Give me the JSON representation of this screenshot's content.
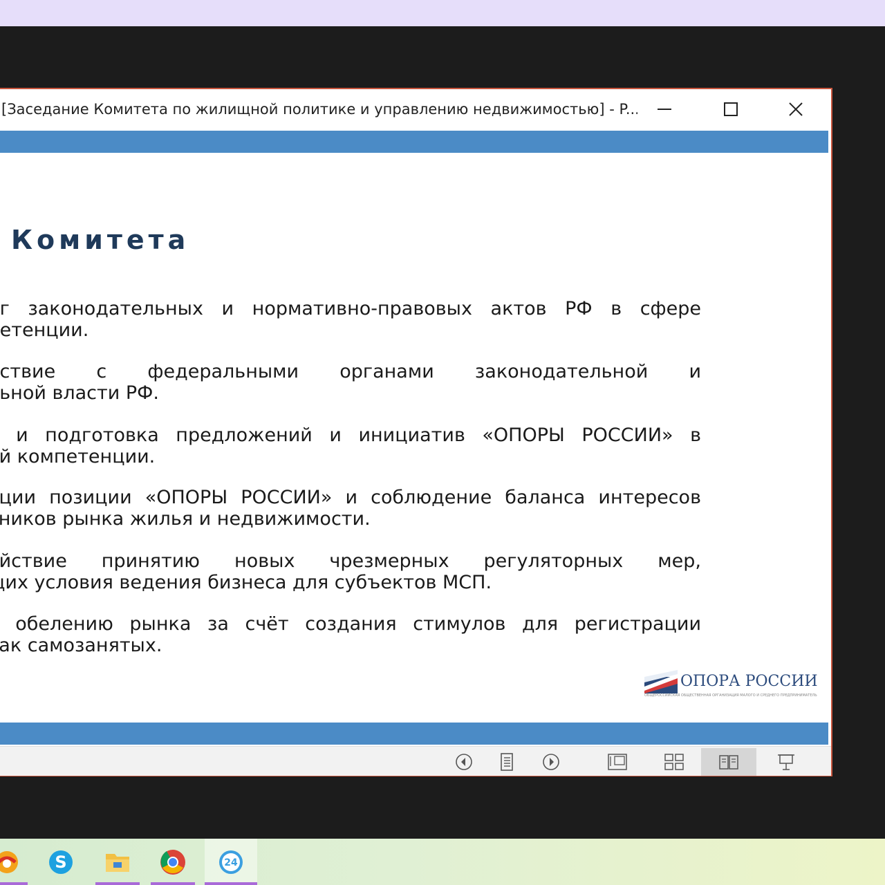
{
  "window": {
    "title": "[Заседание Комитета по жилищной политике и управлению недвижимостью] - P..."
  },
  "slide": {
    "title": "Комитета",
    "bullets": [
      {
        "line1": "нг законодательных и нормативно-правовых актов РФ в сфере",
        "line2": "петенции."
      },
      {
        "line1": "йствие с федеральными органами законодательной и",
        "line2": "льной власти РФ."
      },
      {
        "line1": "а и подготовка предложений и инициатив «ОПОРЫ РОССИИ» в",
        "line2": "ей компетенции."
      },
      {
        "line1": "ации позиции «ОПОРЫ РОССИИ» и соблюдение баланса интересов",
        "line2": "тников рынка жилья и недвижимости."
      },
      {
        "line1": "ействие принятию новых чрезмерных регуляторных мер,",
        "line2": "щих условия ведения бизнеса для субъектов МСП."
      },
      {
        "line1": "е обелению рынка за счёт создания стимулов для регистрации",
        "line2": "как самозанятых."
      }
    ],
    "logo_text": "ОПОРА РОССИИ",
    "logo_subtext": "ОБЩЕРОССИЙСКАЯ ОБЩЕСТВЕННАЯ ОРГАНИЗАЦИЯ МАЛОГО И СРЕДНЕГО ПРЕДПРИНИМАТЕЛЬСТВА"
  },
  "colors": {
    "accent_band": "#4b8bc6",
    "window_border": "#c9563e",
    "title_color": "#1f3a5a"
  },
  "statusbar": {
    "icons": [
      "previous-slide-icon",
      "slide-menu-icon",
      "next-slide-icon",
      "normal-view-icon",
      "slide-sorter-icon",
      "reading-view-icon",
      "slide-show-icon"
    ],
    "active_view": "reading-view-icon"
  },
  "taskbar": {
    "apps": [
      "yandex-browser-icon",
      "skype-icon",
      "file-explorer-icon",
      "chrome-icon",
      "app-24-icon"
    ]
  }
}
